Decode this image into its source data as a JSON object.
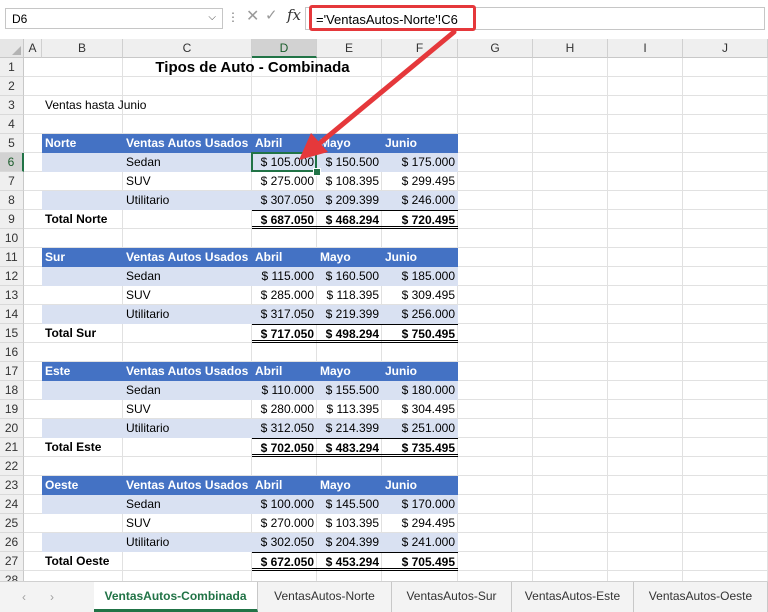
{
  "formula_bar": {
    "name_box": "D6",
    "name_box_arrow": "⌵",
    "separator": "⋮",
    "cancel_icon": "✕",
    "enter_icon": "✓",
    "fx_label": "fx",
    "formula": "='VentasAutos-Norte'!C6"
  },
  "columns": [
    "A",
    "B",
    "C",
    "D",
    "E",
    "F",
    "G",
    "H",
    "I",
    "J"
  ],
  "rows": [
    "1",
    "2",
    "3",
    "4",
    "5",
    "6",
    "7",
    "8",
    "9",
    "10",
    "11",
    "12",
    "13",
    "14",
    "15",
    "16",
    "17",
    "18",
    "19",
    "20",
    "21",
    "22",
    "23",
    "24",
    "25",
    "26",
    "27",
    "28"
  ],
  "sheet": {
    "title": "Tipos de Auto - Combinada",
    "subtitle": "Ventas hasta Junio",
    "header_labels": {
      "category": "Ventas Autos Usados",
      "m1": "Abril",
      "m2": "Mayo",
      "m3": "Junio"
    },
    "regions": [
      {
        "name": "Norte",
        "total_label": "Total Norte",
        "rows": [
          {
            "type": "Sedan",
            "abril": "$ 105.000",
            "mayo": "$ 150.500",
            "junio": "$ 175.000"
          },
          {
            "type": "SUV",
            "abril": "$ 275.000",
            "mayo": "$ 108.395",
            "junio": "$ 299.495"
          },
          {
            "type": "Utilitario",
            "abril": "$ 307.050",
            "mayo": "$ 209.399",
            "junio": "$ 246.000"
          }
        ],
        "totals": {
          "abril": "$ 687.050",
          "mayo": "$ 468.294",
          "junio": "$ 720.495"
        }
      },
      {
        "name": "Sur",
        "total_label": "Total Sur",
        "rows": [
          {
            "type": "Sedan",
            "abril": "$ 115.000",
            "mayo": "$ 160.500",
            "junio": "$ 185.000"
          },
          {
            "type": "SUV",
            "abril": "$ 285.000",
            "mayo": "$ 118.395",
            "junio": "$ 309.495"
          },
          {
            "type": "Utilitario",
            "abril": "$ 317.050",
            "mayo": "$ 219.399",
            "junio": "$ 256.000"
          }
        ],
        "totals": {
          "abril": "$ 717.050",
          "mayo": "$ 498.294",
          "junio": "$ 750.495"
        }
      },
      {
        "name": "Este",
        "total_label": "Total Este",
        "rows": [
          {
            "type": "Sedan",
            "abril": "$ 110.000",
            "mayo": "$ 155.500",
            "junio": "$ 180.000"
          },
          {
            "type": "SUV",
            "abril": "$ 280.000",
            "mayo": "$ 113.395",
            "junio": "$ 304.495"
          },
          {
            "type": "Utilitario",
            "abril": "$ 312.050",
            "mayo": "$ 214.399",
            "junio": "$ 251.000"
          }
        ],
        "totals": {
          "abril": "$ 702.050",
          "mayo": "$ 483.294",
          "junio": "$ 735.495"
        }
      },
      {
        "name": "Oeste",
        "total_label": "Total Oeste",
        "rows": [
          {
            "type": "Sedan",
            "abril": "$ 100.000",
            "mayo": "$ 145.500",
            "junio": "$ 170.000"
          },
          {
            "type": "SUV",
            "abril": "$ 270.000",
            "mayo": "$ 103.395",
            "junio": "$ 294.495"
          },
          {
            "type": "Utilitario",
            "abril": "$ 302.050",
            "mayo": "$ 204.399",
            "junio": "$ 241.000"
          }
        ],
        "totals": {
          "abril": "$ 672.050",
          "mayo": "$ 453.294",
          "junio": "$ 705.495"
        }
      }
    ]
  },
  "tabs": {
    "nav_prev": "‹",
    "nav_next": "›",
    "items": [
      "VentasAutos-Combinada",
      "VentasAutos-Norte",
      "VentasAutos-Sur",
      "VentasAutos-Este",
      "VentasAutos-Oeste"
    ],
    "active": "VentasAutos-Combinada"
  },
  "colors": {
    "header_fill": "#4472c4",
    "band_fill": "#d9e1f2",
    "selection": "#217346",
    "callout": "#e5383b"
  }
}
